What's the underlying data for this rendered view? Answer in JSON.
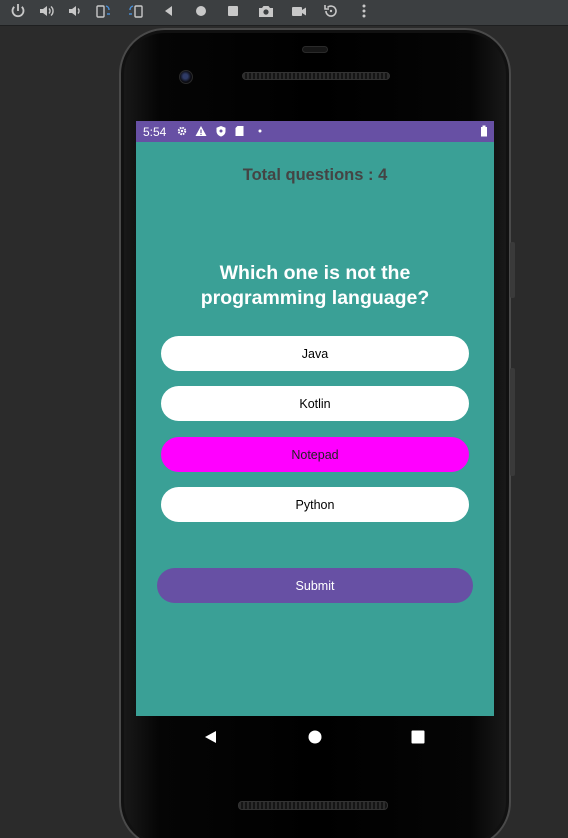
{
  "toolbar": {
    "buttons": [
      {
        "name": "power-icon"
      },
      {
        "name": "volume-up-icon"
      },
      {
        "name": "volume-down-icon"
      },
      {
        "name": "rotate-left-icon"
      },
      {
        "name": "rotate-right-icon"
      },
      {
        "name": "back-icon"
      },
      {
        "name": "home-icon"
      },
      {
        "name": "overview-icon"
      },
      {
        "name": "screenshot-icon"
      },
      {
        "name": "record-icon"
      },
      {
        "name": "undo-icon"
      },
      {
        "name": "more-icon"
      }
    ]
  },
  "statusbar": {
    "time": "5:54",
    "icons": [
      "gear-icon",
      "warning-icon",
      "shield-icon",
      "sd-card-icon",
      "dot-icon",
      "battery-icon"
    ],
    "color": "#6750a4"
  },
  "quiz": {
    "total_label": "Total questions : 4",
    "question": "Which one is not the programming language?",
    "options": [
      "Java",
      "Kotlin",
      "Notepad",
      "Python"
    ],
    "selected_option": "Notepad",
    "submit_label": "Submit",
    "colors": {
      "background": "#3aa096",
      "option": "#ffffff",
      "selected": "#ff00ff",
      "submit": "#6750a4"
    }
  },
  "navbar": {
    "icons": [
      "back-triangle-icon",
      "home-circle-icon",
      "recents-square-icon"
    ]
  }
}
